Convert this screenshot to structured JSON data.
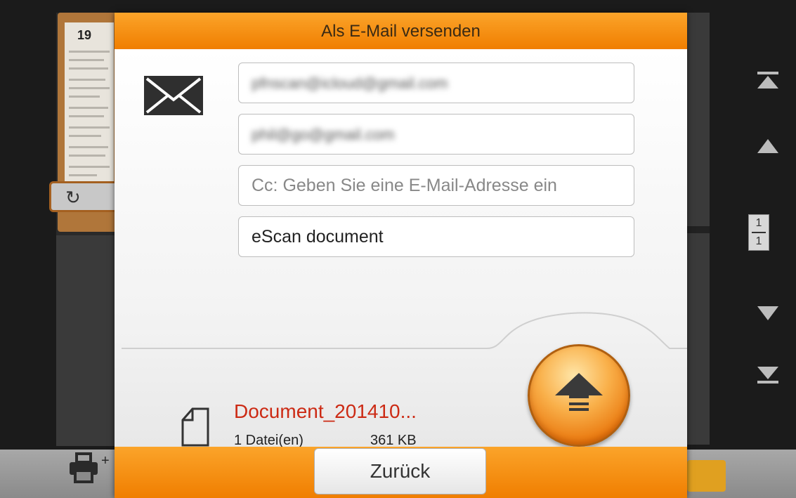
{
  "dialog": {
    "title": "Als E-Mail versenden",
    "to_value": "pfnscan@icloud@gmail.com",
    "from_value": "phil@go@gmail.com",
    "cc_placeholder": "Cc: Geben Sie eine E-Mail-Adresse ein",
    "subject_value": "eScan document",
    "file_name": "Document_201410...",
    "file_count": "1 Datei(en)",
    "file_size": "361 KB",
    "back_label": "Zurück"
  },
  "background": {
    "page_number": "19",
    "page_indicator_current": "1",
    "page_indicator_total": "1"
  },
  "colors": {
    "accent_orange": "#f28a00",
    "filename_red": "#cc2a14"
  }
}
